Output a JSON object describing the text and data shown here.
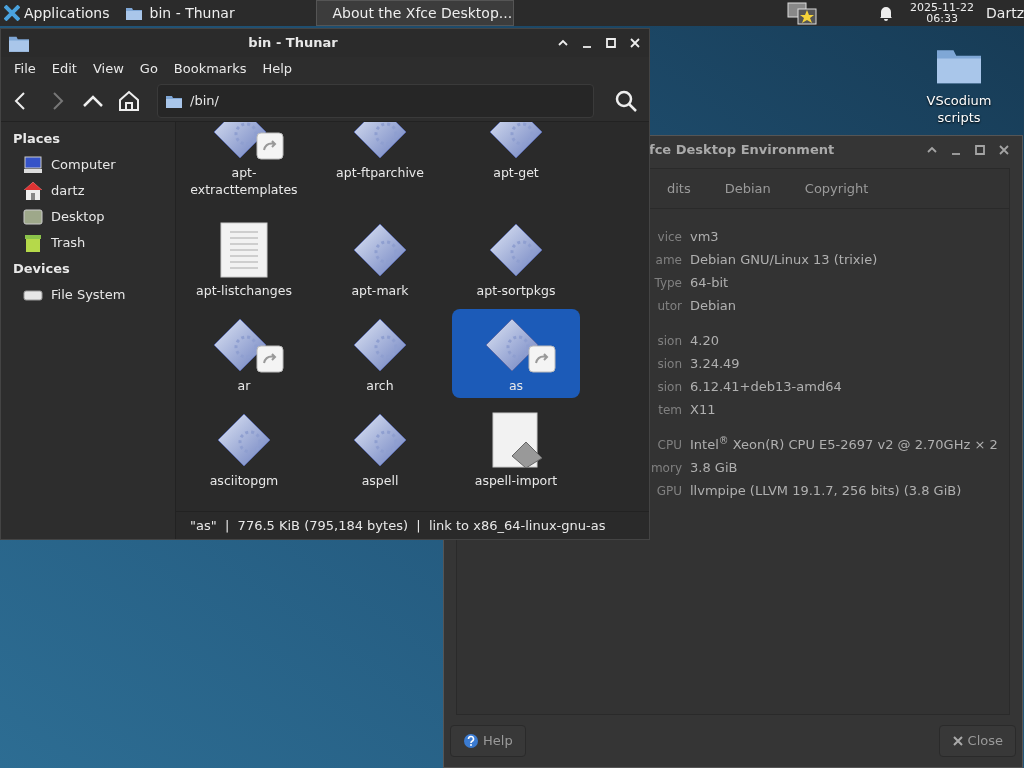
{
  "taskbar": {
    "apps_label": "Applications",
    "tasks": [
      {
        "label": "bin - Thunar",
        "selected": false
      },
      {
        "label": "About the Xfce Desktop...",
        "selected": true
      }
    ],
    "clock": {
      "date": "2025-11-22",
      "time": "06:33"
    },
    "user": "Dartz"
  },
  "desktop_icons": [
    {
      "label": "VScodium scripts"
    }
  ],
  "thunar": {
    "title": "bin - Thunar",
    "menu": [
      "File",
      "Edit",
      "View",
      "Go",
      "Bookmarks",
      "Help"
    ],
    "location": "/bin/",
    "sidebar": [
      {
        "heading": "Places",
        "items": [
          {
            "label": "Computer"
          },
          {
            "label": "dartz"
          },
          {
            "label": "Desktop"
          },
          {
            "label": "Trash"
          }
        ]
      },
      {
        "heading": "Devices",
        "items": [
          {
            "label": "File System"
          }
        ]
      }
    ],
    "files": [
      {
        "name": "apt-extracttemplates",
        "kind": "link",
        "selected": false
      },
      {
        "name": "apt-ftparchive",
        "kind": "exec",
        "selected": false
      },
      {
        "name": "apt-get",
        "kind": "exec",
        "selected": false
      },
      {
        "name": "apt-listchanges",
        "kind": "text",
        "selected": false
      },
      {
        "name": "apt-mark",
        "kind": "exec",
        "selected": false
      },
      {
        "name": "apt-sortpkgs",
        "kind": "exec",
        "selected": false
      },
      {
        "name": "ar",
        "kind": "link",
        "selected": false
      },
      {
        "name": "arch",
        "kind": "exec",
        "selected": false
      },
      {
        "name": "as",
        "kind": "link",
        "selected": true
      },
      {
        "name": "asciitopgm",
        "kind": "exec",
        "selected": false
      },
      {
        "name": "aspell",
        "kind": "exec",
        "selected": false
      },
      {
        "name": "aspell-import",
        "kind": "script",
        "selected": false
      }
    ],
    "status": "\"as\"  |  776.5 KiB (795,184 bytes)  |  link to x86_64-linux-gnu-as"
  },
  "about": {
    "title": "fce Desktop Environment",
    "tabs": [
      "dits",
      "Debian",
      "Copyright"
    ],
    "groups": [
      [
        {
          "label": "vice",
          "value": "vm3"
        },
        {
          "label": "ame",
          "value": "Debian GNU/Linux 13 (trixie)"
        },
        {
          "label": "Type",
          "value": "64-bit"
        },
        {
          "label": "utor",
          "value": "Debian"
        }
      ],
      [
        {
          "label": "sion",
          "value": "4.20"
        },
        {
          "label": "sion",
          "value": "3.24.49"
        },
        {
          "label": "sion",
          "value": "6.12.41+deb13-amd64"
        },
        {
          "label": "tem",
          "value": "X11"
        }
      ],
      [
        {
          "label": "CPU",
          "value": "Intel$^{®}$ Xeon(R) CPU E5-2697 v2 @ 2.70GHz × 2"
        },
        {
          "label": "mory",
          "value": "3.8 GiB"
        },
        {
          "label": "GPU",
          "value": "llvmpipe (LLVM 19.1.7, 256 bits) (3.8 GiB)"
        }
      ]
    ],
    "buttons": {
      "help": "Help",
      "close": "Close"
    }
  }
}
